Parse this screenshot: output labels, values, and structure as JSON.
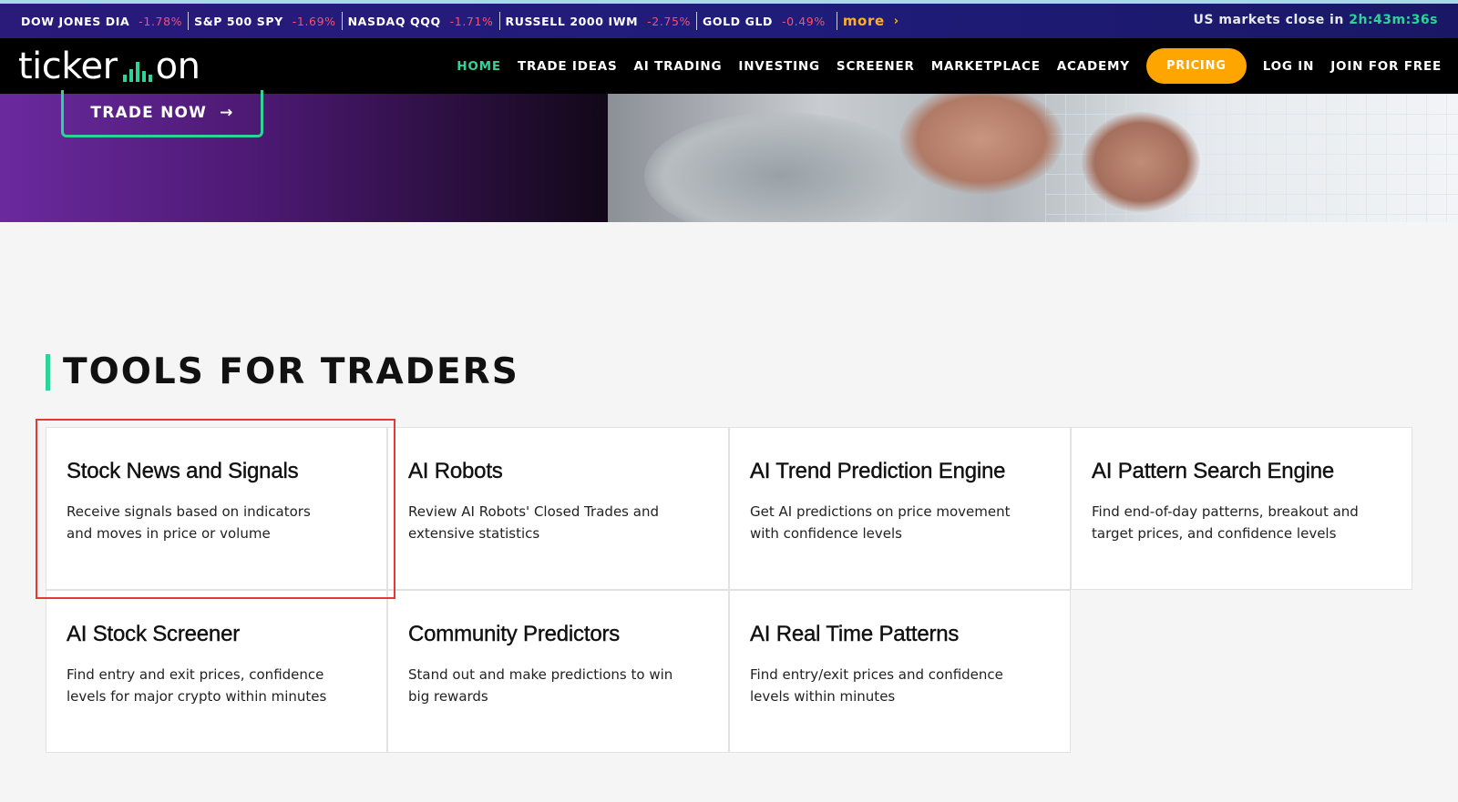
{
  "ticker": {
    "items": [
      {
        "symbol": "DOW JONES DIA",
        "change": "-1.78%"
      },
      {
        "symbol": "S&P 500 SPY",
        "change": "-1.69%"
      },
      {
        "symbol": "NASDAQ QQQ",
        "change": "-1.71%"
      },
      {
        "symbol": "RUSSELL 2000 IWM",
        "change": "-2.75%"
      },
      {
        "symbol": "GOLD GLD",
        "change": "-0.49%"
      }
    ],
    "more_label": "more",
    "market_close_label": "US markets close in",
    "market_close_time": "2h:43m:36s",
    "colors": {
      "negative": "#ff4d6d",
      "more": "#ffb020",
      "time": "#2ed39a"
    }
  },
  "nav": {
    "logo_left": "ticker",
    "logo_right": "on",
    "links": [
      "HOME",
      "TRADE IDEAS",
      "AI TRADING",
      "INVESTING",
      "SCREENER",
      "MARKETPLACE",
      "ACADEMY"
    ],
    "pricing": "PRICING",
    "login": "LOG IN",
    "join": "JOIN FOR FREE",
    "colors": {
      "active": "#2ed39a",
      "pricing_bg": "#ffa500"
    }
  },
  "hero": {
    "cta_label": "TRADE NOW",
    "cta_icon": "arrow-right-icon"
  },
  "section": {
    "title": "TOOLS FOR TRADERS",
    "accent_color": "#2ed39a",
    "cards": [
      {
        "title": "Stock News and Signals",
        "desc": "Receive signals based on indicators and moves in price or volume"
      },
      {
        "title": "AI Robots",
        "desc": "Review AI Robots' Closed Trades and extensive statistics"
      },
      {
        "title": "AI Trend Prediction Engine",
        "desc": "Get AI predictions on price movement with confidence levels"
      },
      {
        "title": "AI Pattern Search Engine",
        "desc": "Find end-of-day patterns, breakout and target prices, and confidence levels"
      },
      {
        "title": "AI Stock Screener",
        "desc": "Find entry and exit prices, confidence levels for major crypto within minutes"
      },
      {
        "title": "Community Predictors",
        "desc": "Stand out and make predictions to win big rewards"
      },
      {
        "title": "AI Real Time Patterns",
        "desc": "Find entry/exit prices and confidence levels within minutes"
      }
    ],
    "highlight_color": "#e53935"
  }
}
